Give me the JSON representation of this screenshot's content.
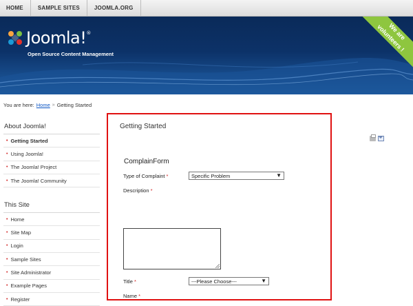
{
  "topnav": {
    "items": [
      "HOME",
      "SAMPLE SITES",
      "JOOMLA.ORG"
    ]
  },
  "banner": {
    "logo_text": "Joomla!",
    "logo_mark": "®",
    "tagline": "Open Source Content Management",
    "ribbon_line1": "We are",
    "ribbon_line2": "volunteers !",
    "colors": {
      "ribbon": "#8ec63f",
      "bg_dark": "#0a2a59"
    }
  },
  "breadcrumb": {
    "prefix": "You are here:",
    "home": "Home",
    "separator": "»",
    "current": "Getting Started"
  },
  "sidebar": {
    "section1": {
      "heading": "About Joomla!",
      "items": [
        "Getting Started",
        "Using Joomla!",
        "The Joomla! Project",
        "The Joomla! Community"
      ]
    },
    "section2": {
      "heading": "This Site",
      "items": [
        "Home",
        "Site Map",
        "Login",
        "Sample Sites",
        "Site Administrator",
        "Example Pages",
        "Register"
      ]
    }
  },
  "main": {
    "page_title": "Getting Started",
    "form_title": "ComplainForm",
    "fields": {
      "complaint_type": {
        "label": "Type of Complaint",
        "required": "*",
        "value": "Specific Problem"
      },
      "description": {
        "label": "Description",
        "required": "*"
      },
      "title": {
        "label": "Title",
        "required": "*",
        "value": "---Please Choose---"
      },
      "name": {
        "label": "Name",
        "required": "*"
      }
    },
    "highlight_color": "#e01010"
  }
}
